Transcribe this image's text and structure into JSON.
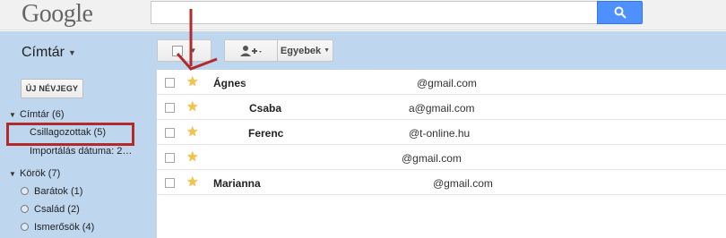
{
  "header": {
    "logo": "Google",
    "search_value": "",
    "search_icon": "search-icon"
  },
  "toolbar": {
    "section_title": "Címtár",
    "add_contact_icon": "add-person-icon",
    "more_label": "Egyebek"
  },
  "sidebar": {
    "new_contact_label": "ÚJ NÉVJEGY",
    "items": [
      {
        "label": "Címtár (6)"
      },
      {
        "label": "Csillagozottak (5)"
      },
      {
        "label": "Importálás dátuma: 2…"
      },
      {
        "label": "Körök (7)"
      },
      {
        "label": "Barátok (1)"
      },
      {
        "label": "Család (2)"
      },
      {
        "label": "Ismerősök (4)"
      }
    ]
  },
  "contacts": [
    {
      "name": "Ágnes",
      "email": "@gmail.com"
    },
    {
      "name": "Csaba",
      "email": "a@gmail.com"
    },
    {
      "name": "Ferenc",
      "email": "@t-online.hu"
    },
    {
      "name": "",
      "email": "@gmail.com"
    },
    {
      "name": "Marianna",
      "email": "@gmail.com"
    }
  ],
  "colors": {
    "accent_blue": "#4d90fe",
    "sidebar_bg": "#bfd6ef",
    "annotation_red": "#b22a2a",
    "star": "#f6c342"
  }
}
